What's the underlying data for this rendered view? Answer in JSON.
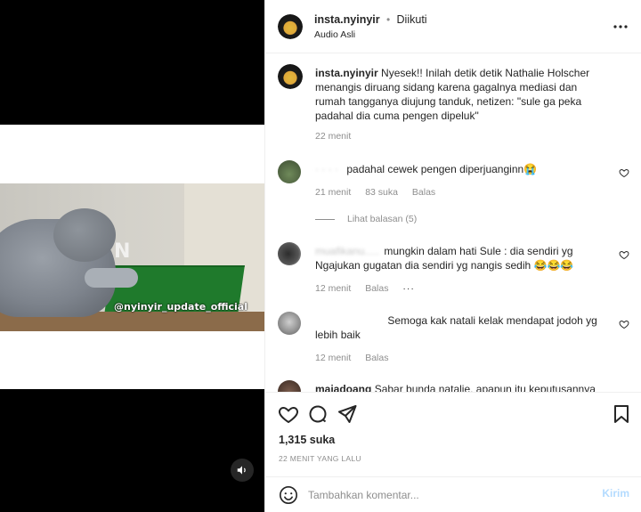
{
  "video": {
    "watermark": "@nyinyir_update_official",
    "logo_text": "N",
    "sound_icon": "volume-icon"
  },
  "header": {
    "username": "insta.nyinyir",
    "separator": "•",
    "follow_status": "Diikuti",
    "audio": "Audio Asli",
    "more_icon": "more-options-icon"
  },
  "caption": {
    "username": "insta.nyinyir",
    "text": "Nyesek!! Inilah detik detik Nathalie Holscher menangis diruang sidang karena gagalnya mediasi dan rumah tangganya diujung tanduk, netizen: \"sule ga peka padahal dia cuma pengen dipeluk\"",
    "time": "22 menit"
  },
  "comments": [
    {
      "username": "· · · ·",
      "text": "padahal cewek pengen diperjuanginn😭",
      "time": "21 menit",
      "likes": "83 suka",
      "reply": "Balas",
      "view_replies": "Lihat balasan (5)"
    },
    {
      "username": "muafikanu.....",
      "text": "mungkin dalam hati Sule : dia sendiri yg Ngajukan gugatan dia sendiri yg nangis sedih 😂😂😂",
      "time": "12 menit",
      "reply": "Balas",
      "more": "···"
    },
    {
      "username": "",
      "text": "Semoga kak natali kelak mendapat jodoh yg lebih baik",
      "time": "12 menit",
      "reply": "Balas"
    },
    {
      "username": "majadoang",
      "text": "Sabar bunda natalie, apapun itu keputusannya"
    }
  ],
  "actions": {
    "likes": "1,315 suka",
    "time_ago": "22 MENIT YANG LALU"
  },
  "composer": {
    "placeholder": "Tambahkan komentar...",
    "post_label": "Kirim"
  },
  "colors": {
    "accent": "#0095f6",
    "post_disabled": "#b3dbff",
    "muted": "#8e8e8e",
    "border": "#efefef"
  }
}
